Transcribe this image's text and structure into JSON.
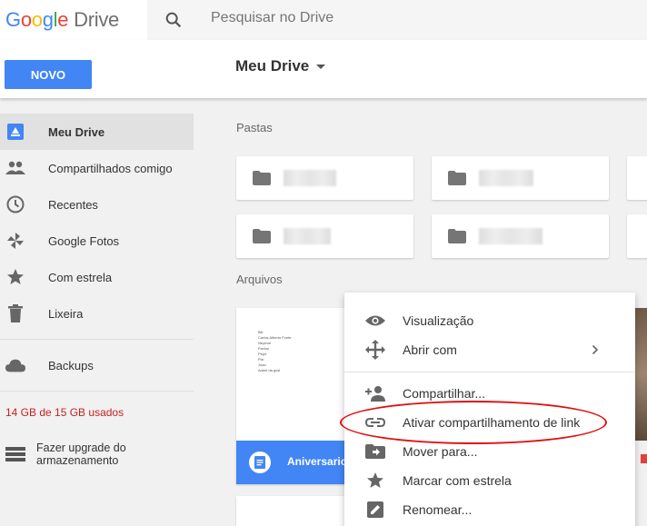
{
  "header": {
    "logo_word": "Google",
    "logo_product": "Drive",
    "search_placeholder": "Pesquisar no Drive"
  },
  "subbar": {
    "new_button": "NOVO",
    "location_title": "Meu Drive"
  },
  "sidebar": {
    "items": [
      {
        "label": "Meu Drive",
        "icon": "drive-icon",
        "active": true
      },
      {
        "label": "Compartilhados comigo",
        "icon": "people-icon"
      },
      {
        "label": "Recentes",
        "icon": "clock-icon"
      },
      {
        "label": "Google Fotos",
        "icon": "pinwheel-icon"
      },
      {
        "label": "Com estrela",
        "icon": "star-icon"
      },
      {
        "label": "Lixeira",
        "icon": "trash-icon"
      }
    ],
    "backups_label": "Backups",
    "storage_text": "14 GB de 15 GB usados",
    "upgrade_label": "Fazer upgrade do armazenamento"
  },
  "main": {
    "folders_heading": "Pastas",
    "files_heading": "Arquivos",
    "file_card": {
      "name": "Aniversario",
      "preview_lines": [
        "Bili",
        "Carlos Alberto Fonte",
        "Neymar",
        "Pavlon",
        "Pepe",
        "Pizi",
        "Joao",
        "Adriel da gosi"
      ]
    }
  },
  "context_menu": {
    "items": [
      {
        "label": "Visualização",
        "icon": "eye-icon"
      },
      {
        "label": "Abrir com",
        "icon": "move-arrows-icon",
        "has_submenu": true
      },
      {
        "label": "Compartilhar...",
        "icon": "add-person-icon"
      },
      {
        "label": "Ativar compartilhamento de link",
        "icon": "link-icon",
        "highlighted": true
      },
      {
        "label": "Mover para...",
        "icon": "move-to-folder-icon"
      },
      {
        "label": "Marcar com estrela",
        "icon": "star-icon"
      },
      {
        "label": "Renomear...",
        "icon": "pencil-icon"
      }
    ]
  },
  "colors": {
    "brand_blue": "#4285f4",
    "storage_warning": "#c5221f",
    "annotation_red": "#e00f0f"
  }
}
